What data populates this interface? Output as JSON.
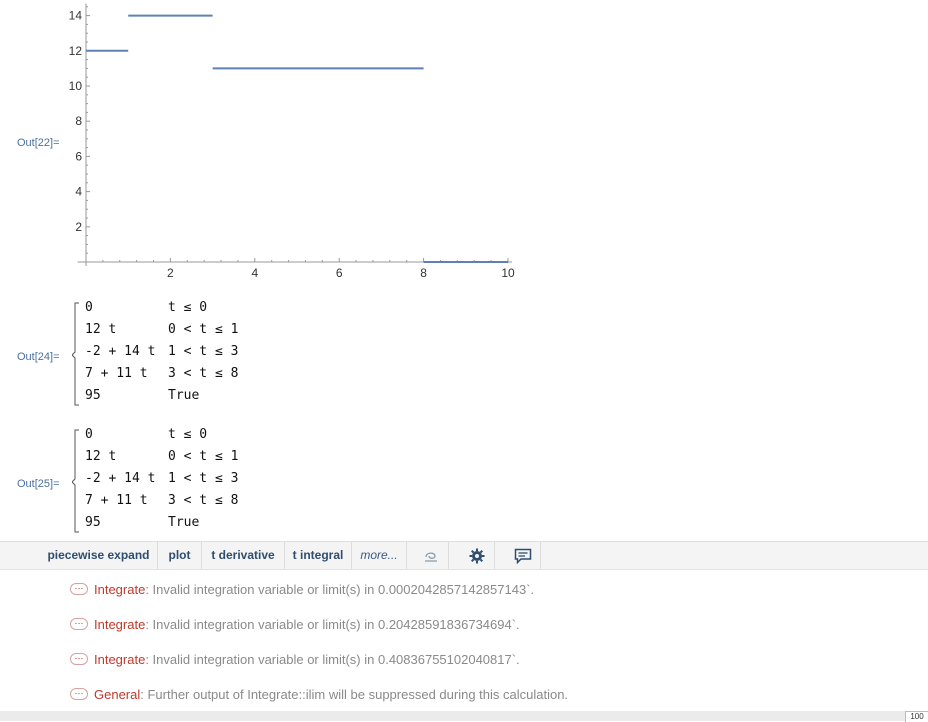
{
  "outputs": {
    "out22": "Out[22]=",
    "out24": "Out[24]=",
    "out25": "Out[25]="
  },
  "chart_data": {
    "type": "line",
    "xticks": [
      "2",
      "4",
      "6",
      "8",
      "10"
    ],
    "yticks": [
      "2",
      "4",
      "6",
      "8",
      "10",
      "12",
      "14"
    ],
    "xlim": [
      0,
      10
    ],
    "ylim": [
      0,
      14
    ],
    "segments": [
      {
        "x": [
          0,
          1
        ],
        "y": [
          12,
          12
        ]
      },
      {
        "x": [
          1,
          3
        ],
        "y": [
          14,
          14
        ]
      },
      {
        "x": [
          3,
          8
        ],
        "y": [
          11,
          11
        ]
      },
      {
        "x": [
          8,
          10
        ],
        "y": [
          0,
          0
        ]
      }
    ],
    "line_color": "#5e81b5"
  },
  "piecewise": [
    {
      "expr": "0",
      "cond": "t ≤ 0"
    },
    {
      "expr": "12 t",
      "cond": "0 < t ≤ 1"
    },
    {
      "expr": "-2 + 14 t",
      "cond": "1 < t ≤ 3"
    },
    {
      "expr": "7 + 11 t",
      "cond": "3 < t ≤ 8"
    },
    {
      "expr": "95",
      "cond": "True"
    }
  ],
  "suggestions": {
    "piecewise_expand": "piecewise expand",
    "plot": "plot",
    "t_derivative": "t derivative",
    "t_integral": "t integral",
    "more": "more...",
    "icons": [
      "spiral-icon",
      "gear-icon",
      "feedback-icon"
    ]
  },
  "messages": [
    {
      "sym": "Integrate",
      "text": ": Invalid integration variable or limit(s) in 0.0002042857142857143`."
    },
    {
      "sym": "Integrate",
      "text": ": Invalid integration variable or limit(s) in 0.20428591836734694`."
    },
    {
      "sym": "Integrate",
      "text": ": Invalid integration variable or limit(s) in 0.40836755102040817`."
    },
    {
      "sym": "General",
      "text": ": Further output of ",
      "link": "Integrate::ilim",
      "tail": " will be suppressed during this calculation."
    }
  ],
  "ellipsis": "⋯",
  "zoom": "100"
}
